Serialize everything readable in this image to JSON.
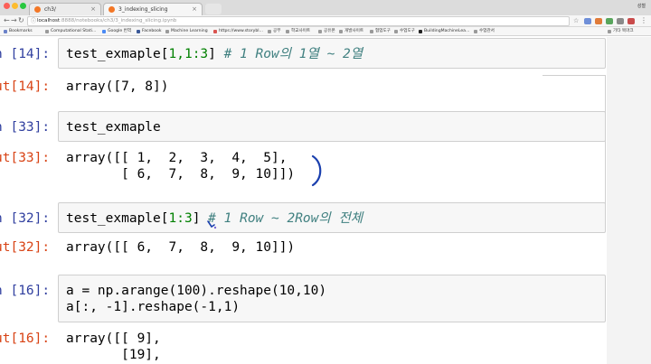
{
  "browser": {
    "tabs": [
      {
        "label": "ch3/",
        "active": false
      },
      {
        "label": "3_indexing_slicing",
        "active": true
      }
    ],
    "profile": "성철",
    "address": {
      "host": "localhost",
      "path": ":8888/notebooks/ch3/3_indexing_slicing.ipynb"
    },
    "bookmarks": [
      "Bookmarks",
      "Computational Stati...",
      "Google 번역",
      "Facebook",
      "Machine Learning",
      "https://www.storybl...",
      "공부",
      "학교사이트",
      "공유폰",
      "개발사이트",
      "협업도구",
      "수업도구",
      "BuildingMachineLea...",
      "수업관서",
      "기타 북마크"
    ]
  },
  "cells": [
    {
      "in_prompt": "n [14]:",
      "out_prompt": "ut[14]:",
      "code_name": "test_exmaple",
      "code_args": "1,1:3",
      "comment": "# 1 Row의 1열 ~ 2열",
      "output": [
        "array([7, 8])"
      ]
    },
    {
      "in_prompt": "n [33]:",
      "out_prompt": "ut[33]:",
      "code_name": "test_exmaple",
      "output": [
        "array([[ 1,  2,  3,  4,  5],",
        "       [ 6,  7,  8,  9, 10]])"
      ]
    },
    {
      "in_prompt": "n [32]:",
      "out_prompt": "ut[32]:",
      "code_name": "test_exmaple",
      "code_args": "1:3",
      "comment": "# 1 Row ~ 2Row의 전체",
      "output": [
        "array([[ 6,  7,  8,  9, 10]])"
      ]
    },
    {
      "in_prompt": "n [16]:",
      "out_prompt": "ut[16]:",
      "code_line1": "a = np.arange(100).reshape(10,10)",
      "code_line2": "a[:, -1].reshape(-1,1)",
      "output": [
        "array([[ 9],",
        "       [19],"
      ]
    }
  ],
  "colors": {
    "in_prompt": "#303f9f",
    "out_prompt": "#d84315",
    "number": "#008000",
    "comment": "#408080",
    "annotation": "#1a3fae"
  }
}
